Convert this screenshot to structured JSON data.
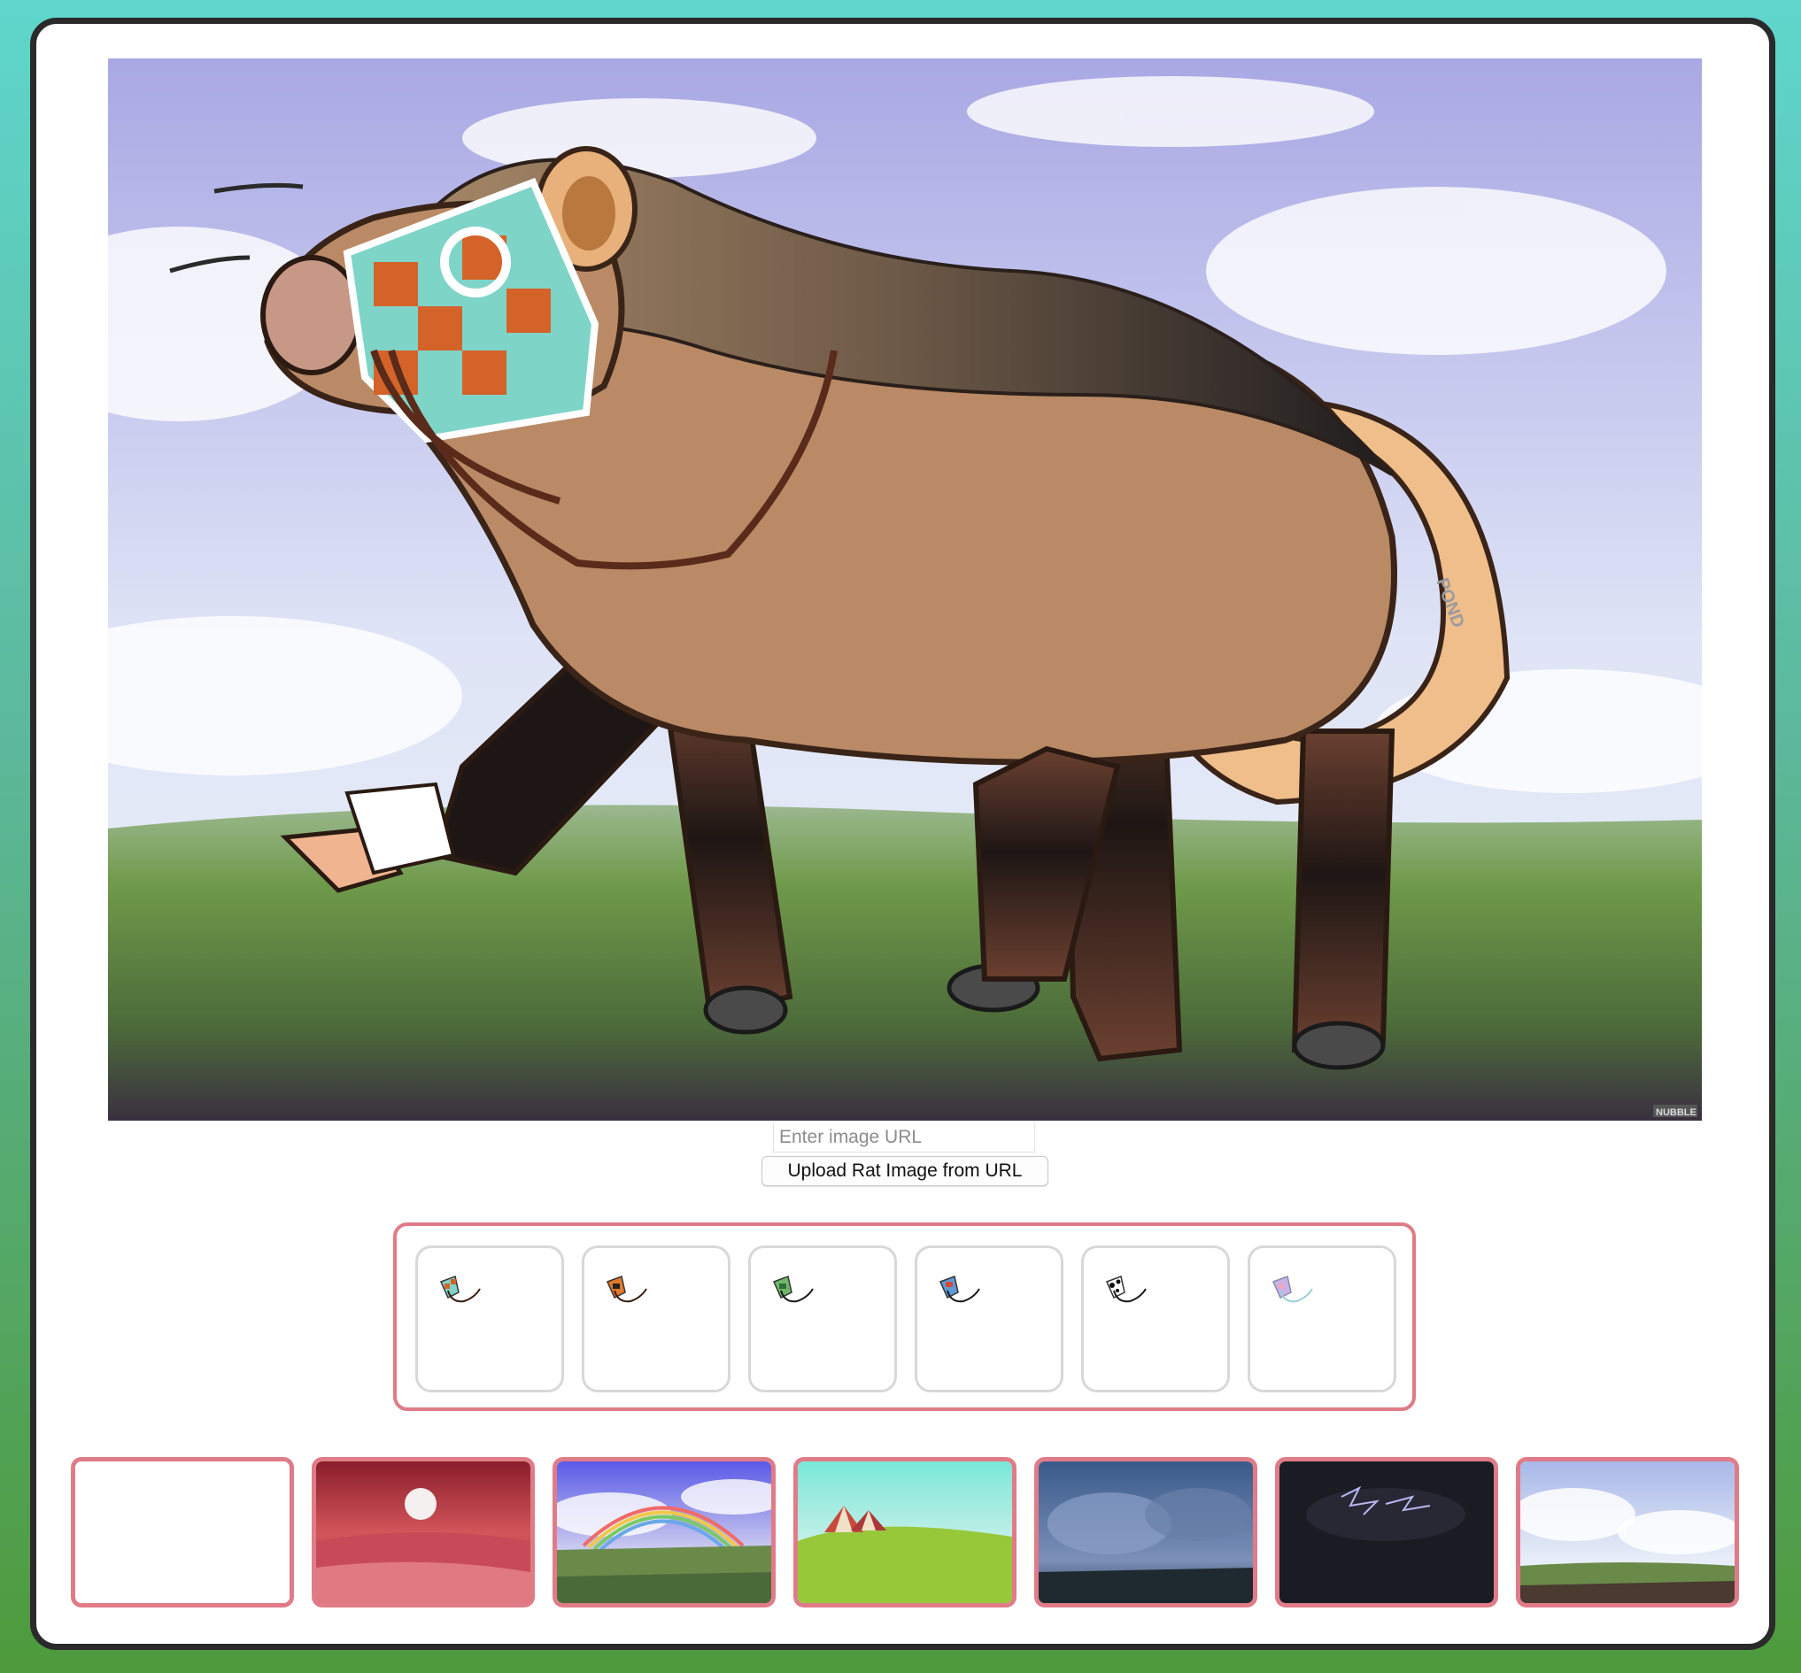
{
  "main_image": {
    "signature": "POND",
    "watermark": "NUBBLE"
  },
  "url_input": {
    "placeholder": "Enter image URL",
    "value": ""
  },
  "upload_button": {
    "label": "Upload Rat Image from URL"
  },
  "accessories": [
    {
      "name": "checkered-mask-bridle-icon"
    },
    {
      "name": "orange-black-mask-bridle-icon"
    },
    {
      "name": "green-mask-bridle-icon"
    },
    {
      "name": "blue-red-mask-bridle-icon"
    },
    {
      "name": "cow-print-mask-bridle-icon"
    },
    {
      "name": "pastel-mask-bridle-icon"
    }
  ],
  "backgrounds": [
    {
      "name": "blank-background"
    },
    {
      "name": "red-moon-background"
    },
    {
      "name": "rainbow-field-background"
    },
    {
      "name": "circus-tent-background"
    },
    {
      "name": "stormy-plains-background"
    },
    {
      "name": "lightning-night-background"
    },
    {
      "name": "cloudy-meadow-background"
    }
  ],
  "colors": {
    "accent_border": "#e07b88",
    "card_border": "#2a2a2a",
    "page_gradient_top": "#5fd6cc",
    "page_gradient_bottom": "#4e9a3c"
  }
}
